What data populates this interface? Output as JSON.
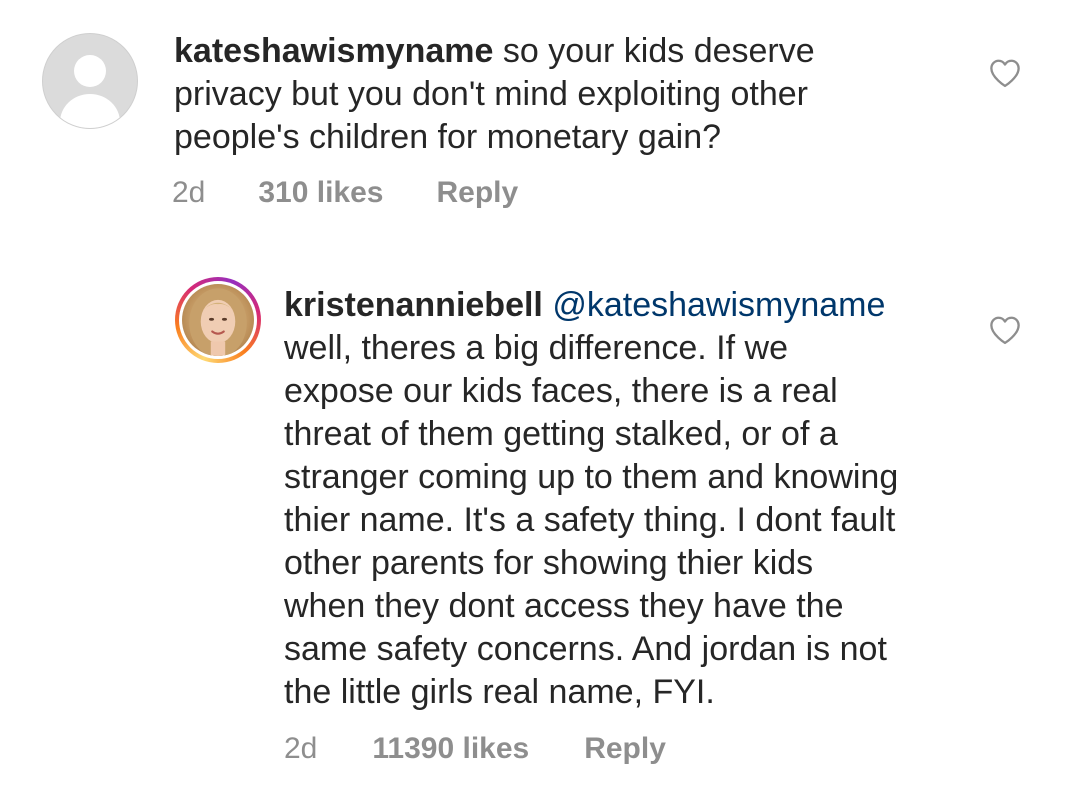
{
  "comments": [
    {
      "username": "kateshawismyname",
      "lines": [
        " so your kids deserve",
        "privacy but you don't mind exploiting other",
        "people's children for monetary gain?"
      ],
      "time": "2d",
      "likes": "310 likes",
      "reply_label": "Reply",
      "avatar": "default-avatar-icon",
      "like_icon": "heart-outline-icon"
    },
    {
      "username": "kristenanniebell",
      "mention": "@kateshawismyname",
      "lines": [
        "well, theres a big difference. If we",
        "expose our kids faces, there is a real",
        "threat of them getting stalked, or of a",
        "stranger coming up to them and knowing",
        "thier name. It's a safety thing. I dont fault",
        "other parents for showing thier kids",
        "when they dont access they have the",
        "same safety concerns. And jordan is not",
        "the little girls real name, FYI."
      ],
      "time": "2d",
      "likes": "11390 likes",
      "reply_label": "Reply",
      "avatar": "profile-photo-with-story-ring",
      "like_icon": "heart-outline-icon"
    }
  ],
  "colors": {
    "text": "#262626",
    "meta": "#8e8e8e",
    "mention": "#00376b",
    "avatar_placeholder": "#dbdbdb"
  }
}
